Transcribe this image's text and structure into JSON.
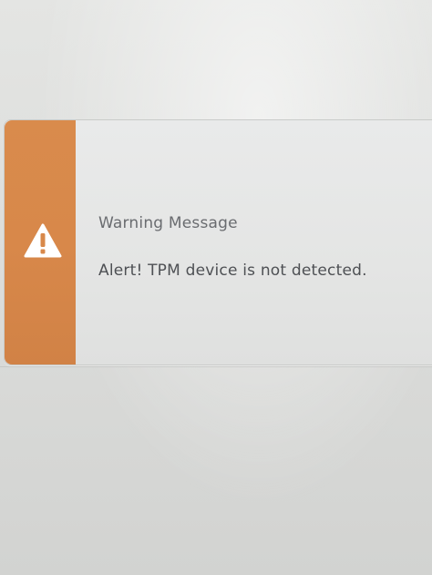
{
  "dialog": {
    "title": "Warning Message",
    "message": "Alert! TPM device is not detected.",
    "icon": "warning-icon",
    "accent_color": "#d8884a"
  }
}
